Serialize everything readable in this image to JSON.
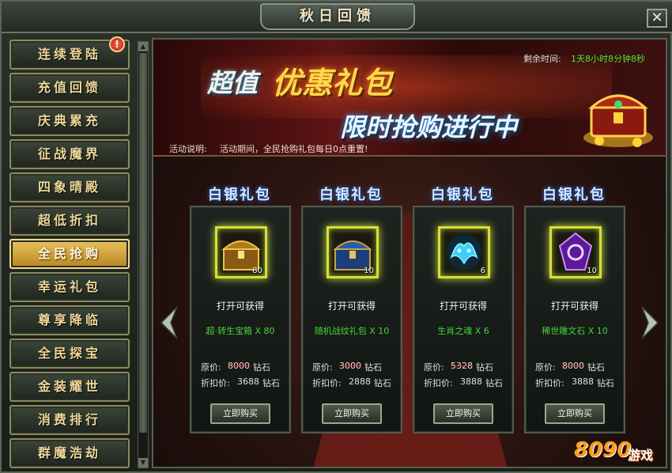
{
  "window": {
    "title": "秋日回馈",
    "close_symbol": "✕"
  },
  "sidebar": {
    "items": [
      {
        "label": "连续登陆",
        "active": false
      },
      {
        "label": "充值回馈",
        "active": false
      },
      {
        "label": "庆典累充",
        "active": false
      },
      {
        "label": "征战魔界",
        "active": false
      },
      {
        "label": "四象晴殿",
        "active": false
      },
      {
        "label": "超低折扣",
        "active": false
      },
      {
        "label": "全民抢购",
        "active": true
      },
      {
        "label": "幸运礼包",
        "active": false
      },
      {
        "label": "尊享降临",
        "active": false
      },
      {
        "label": "全民探宝",
        "active": false
      },
      {
        "label": "金装耀世",
        "active": false
      },
      {
        "label": "消费排行",
        "active": false
      },
      {
        "label": "群魔浩劫",
        "active": false
      }
    ],
    "alert_badge": "!"
  },
  "banner": {
    "timer_label": "剩余时间:",
    "timer_value": "1天8小时8分钟8秒",
    "title_part1": "超值",
    "title_part2": "优惠礼包",
    "subtitle": "限时抢购进行中",
    "desc_label": "活动说明:",
    "desc_text": "活动期间，全民抢购礼包每日0点重置!"
  },
  "cards": [
    {
      "title": "白银礼包",
      "item_icon": "gold-treasure-chest-icon",
      "count": "80",
      "open_label": "打开可获得",
      "reward": "超·转生宝箱 X 80",
      "orig_label": "原价:",
      "orig_price": "8000",
      "orig_unit": "钻石",
      "disc_label": "折扣价:",
      "disc_price": "3688",
      "disc_unit": "钻石",
      "buy": "立即购买"
    },
    {
      "title": "白银礼包",
      "item_icon": "blue-treasure-chest-icon",
      "count": "10",
      "open_label": "打开可获得",
      "reward": "随机战纹礼包 X 10",
      "orig_label": "原价:",
      "orig_price": "3000",
      "orig_unit": "钻石",
      "disc_label": "折扣价:",
      "disc_price": "2888",
      "disc_unit": "钻石",
      "buy": "立即购买"
    },
    {
      "title": "白银礼包",
      "item_icon": "zodiac-soul-icon",
      "count": "6",
      "open_label": "打开可获得",
      "reward": "生肖之魂 X 6",
      "orig_label": "原价:",
      "orig_price": "5328",
      "orig_unit": "钻石",
      "disc_label": "折扣价:",
      "disc_price": "3888",
      "disc_unit": "钻石",
      "buy": "立即购买"
    },
    {
      "title": "白银礼包",
      "item_icon": "purple-rune-stone-icon",
      "count": "10",
      "open_label": "打开可获得",
      "reward": "稀世雕文石 X 10",
      "orig_label": "原价:",
      "orig_price": "8000",
      "orig_unit": "钻石",
      "disc_label": "折扣价:",
      "disc_price": "3888",
      "disc_unit": "钻石",
      "buy": "立即购买"
    }
  ],
  "watermark": {
    "number": "8090",
    "text": "游戏"
  }
}
